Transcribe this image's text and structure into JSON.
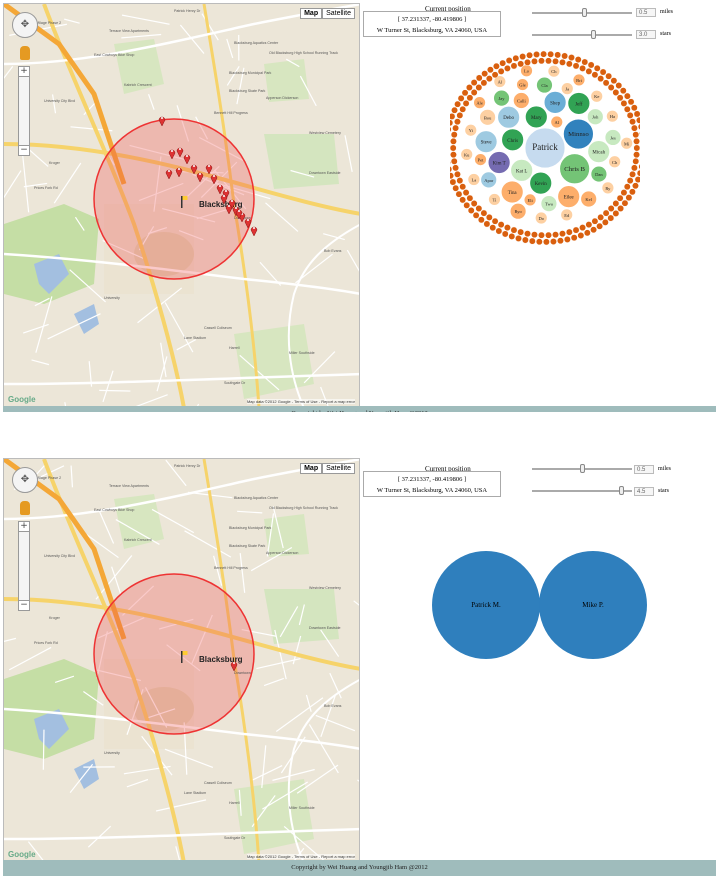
{
  "map": {
    "type_map": "Map",
    "type_satellite": "Satellite",
    "city_label": "Blacksburg",
    "attribution": "Map data ©2012 Google - Terms of Use - Report a map error",
    "logo": "Google",
    "street_labels": [
      "Patrick Henry Dr",
      "The Village Phase 2",
      "Terrace View Apartments",
      "East Cowboys Bike Shop",
      "Blacksburg Aquatics Center",
      "Old Blacksburg High School Running Track",
      "Blacksburg Municipal Park",
      "Kabrich Crescent",
      "Blacksburg Skate Park",
      "Apperson Dickerson",
      "Bennett Hill Progress",
      "Westview Cemetery",
      "Downtown Eastside",
      "Downtown",
      "Prices Fork Rd",
      "University City Blvd",
      "University",
      "Lane Stadium",
      "Cassell Coliseum",
      "Harrell",
      "Miller Southside",
      "Southgate Dr",
      "Bob Evans",
      "Kroger"
    ]
  },
  "controls": {
    "position_label": "Current position",
    "coords": "[ 37.231337, -80.419806 ]",
    "address": "W Turner St, Blacksburg, VA 24060, USA",
    "miles_unit": "miles",
    "stars_unit": "stars"
  },
  "panel1": {
    "miles": "0.5",
    "stars": "3.0"
  },
  "panel2": {
    "miles": "0.5",
    "stars": "4.5"
  },
  "footer": "Copyright by Wei Huang and Youngjib Ham @2012",
  "bubbles_panel1": [
    {
      "label": "Patrick",
      "size": "xl",
      "color": "#c6dbef"
    },
    {
      "label": "Minnso",
      "size": "l",
      "color": "#3182bd"
    },
    {
      "label": "Chris B",
      "size": "l",
      "color": "#74c476"
    },
    {
      "label": "Kat L",
      "size": "m",
      "color": "#c7e9c0"
    },
    {
      "label": "Chris",
      "size": "m",
      "color": "#31a354"
    },
    {
      "label": "Mary",
      "size": "m",
      "color": "#31a354"
    },
    {
      "label": "Kevin",
      "size": "m",
      "color": "#31a354"
    },
    {
      "label": "Kim T",
      "size": "m",
      "color": "#756bb1"
    },
    {
      "label": "Debo",
      "size": "m",
      "color": "#9ecae1"
    },
    {
      "label": "Shep",
      "size": "m",
      "color": "#6baed6"
    },
    {
      "label": "Micah",
      "size": "m",
      "color": "#c7e9c0"
    },
    {
      "label": "Eilee",
      "size": "m",
      "color": "#fdae6b"
    },
    {
      "label": "Tina",
      "size": "m",
      "color": "#fdae6b"
    },
    {
      "label": "Jeff",
      "size": "m",
      "color": "#31a354"
    },
    {
      "label": "Steve",
      "size": "m",
      "color": "#9ecae1"
    },
    {
      "label": "Calli",
      "size": "s",
      "color": "#fdae6b"
    },
    {
      "label": "Twa",
      "size": "s",
      "color": "#c7e9c0"
    },
    {
      "label": "Joh",
      "size": "s",
      "color": "#c7e9c0"
    },
    {
      "label": "Dan",
      "size": "s",
      "color": "#74c476"
    },
    {
      "label": "Apar",
      "size": "s",
      "color": "#9ecae1"
    },
    {
      "label": "Bou",
      "size": "s",
      "color": "#fdd0a2"
    },
    {
      "label": "Cla",
      "size": "s",
      "color": "#74c476"
    },
    {
      "label": "Jay",
      "size": "s",
      "color": "#74c476"
    },
    {
      "label": "Jes",
      "size": "s",
      "color": "#c7e9c0"
    },
    {
      "label": "Kel",
      "size": "s",
      "color": "#fdae6b"
    },
    {
      "label": "Ryo",
      "size": "s",
      "color": "#fdae6b"
    },
    {
      "label": "Al",
      "size": "xs",
      "color": "#fdae6b"
    },
    {
      "label": "Eli",
      "size": "xs",
      "color": "#fdae6b"
    },
    {
      "label": "Pet",
      "size": "xs",
      "color": "#fdae6b"
    },
    {
      "label": "Ja",
      "size": "xs",
      "color": "#fdd0a2"
    },
    {
      "label": "Gle",
      "size": "xs",
      "color": "#fdae6b"
    },
    {
      "label": "Ch",
      "size": "xs",
      "color": "#fdd0a2"
    },
    {
      "label": "Ed",
      "size": "xs",
      "color": "#fdd0a2"
    },
    {
      "label": "Do",
      "size": "xs",
      "color": "#fdd0a2"
    },
    {
      "label": "Ti",
      "size": "xs",
      "color": "#fdd0a2"
    },
    {
      "label": "Ke",
      "size": "xs",
      "color": "#fdd0a2"
    },
    {
      "label": "Ha",
      "size": "xs",
      "color": "#fdd0a2"
    },
    {
      "label": "Ry",
      "size": "xs",
      "color": "#fdd0a2"
    },
    {
      "label": "Yi",
      "size": "xs",
      "color": "#fdd0a2"
    },
    {
      "label": "La",
      "size": "xs",
      "color": "#fdd0a2"
    },
    {
      "label": "Ku",
      "size": "xs",
      "color": "#fdd0a2"
    },
    {
      "label": "Bri",
      "size": "xs",
      "color": "#fdae6b"
    },
    {
      "label": "Ale",
      "size": "xs",
      "color": "#fdae6b"
    },
    {
      "label": "Ch",
      "size": "xs",
      "color": "#fdd0a2"
    },
    {
      "label": "Mi",
      "size": "xs",
      "color": "#fdd0a2"
    },
    {
      "label": "Al",
      "size": "xs",
      "color": "#fdd0a2"
    },
    {
      "label": "Lo",
      "size": "xs",
      "color": "#fdae6b"
    }
  ],
  "bubbles_panel2": [
    {
      "label": "Patrick M.",
      "color": "#2f7fbd"
    },
    {
      "label": "Mike P.",
      "color": "#2f7fbd"
    }
  ]
}
